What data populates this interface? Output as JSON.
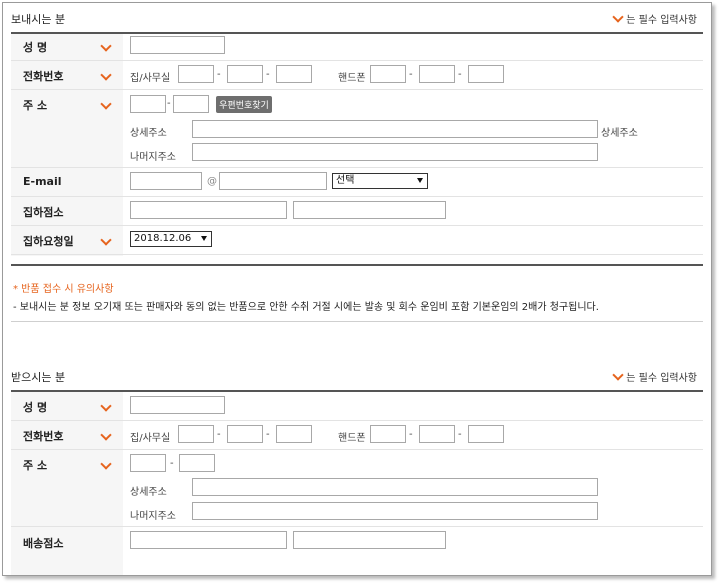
{
  "sender": {
    "title": "보내시는 분",
    "required_note": "는 필수 입력사항",
    "labels": {
      "name": "성 명",
      "phone": "전화번호",
      "address": "주 소",
      "email": "E-mail",
      "pickup_point": "집하점소",
      "pickup_date": "집하요청일"
    },
    "home_phone_label": "집/사무실",
    "mobile_label": "핸드폰",
    "dash": "-",
    "zip_button": "우편번호찾기",
    "detail_address_label": "상세주소",
    "detail_address_suffix": "상세주소",
    "rest_address_label": "나머지주소",
    "at_sign": "@",
    "email_domain_select": "선택",
    "pickup_date_value": "2018.12.06"
  },
  "notice": {
    "title": "* 반품 접수 시 유의사항",
    "body": "- 보내시는 분 정보 오기재 또는 판매자와 동의 없는 반품으로 안한 수취 거절 시에는 발송 및 회수 운임비 포함 기본운임의 2배가 청구됩니다."
  },
  "receiver": {
    "title": "받으시는 분",
    "required_note": "는 필수 입력사항",
    "labels": {
      "name": "성 명",
      "phone": "전화번호",
      "address": "주 소",
      "delivery_point": "배송점소"
    },
    "home_phone_label": "집/사무실",
    "mobile_label": "핸드폰",
    "dash": "-",
    "detail_address_label": "상세주소",
    "rest_address_label": "나머지주소"
  },
  "colors": {
    "accent": "#e6641e",
    "label_bg": "#f6f6f6",
    "button_bg": "#6e6e6e"
  }
}
